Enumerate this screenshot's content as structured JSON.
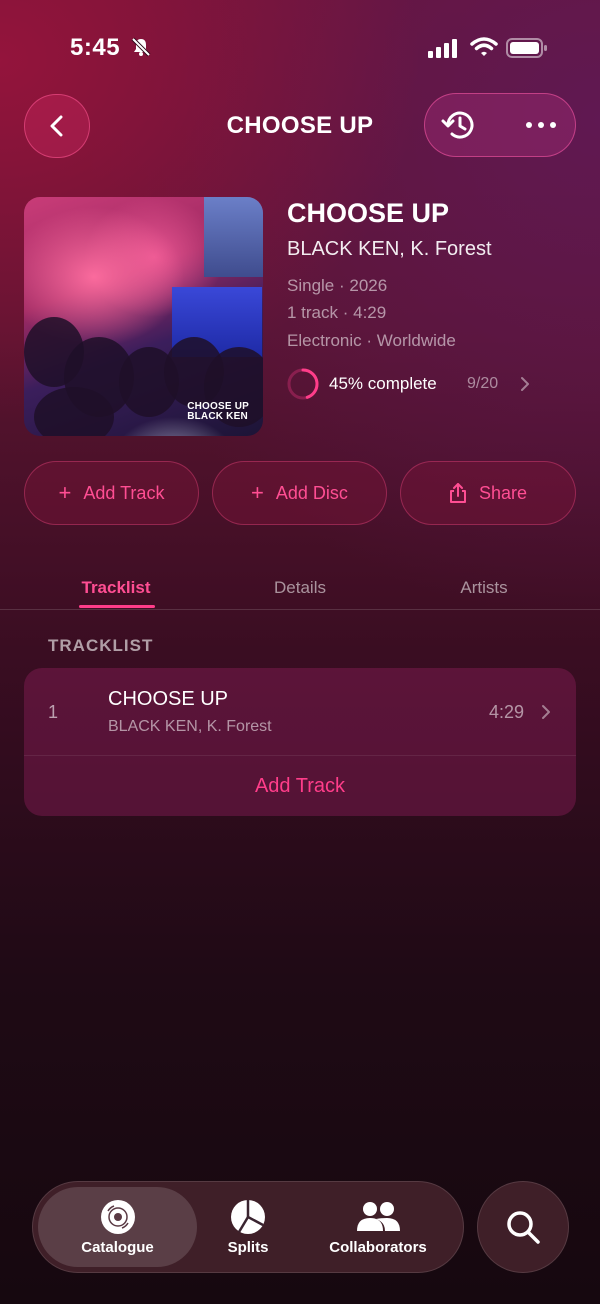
{
  "status_bar": {
    "time": "5:45"
  },
  "header": {
    "title": "CHOOSE UP"
  },
  "release": {
    "cover_text_line1": "CHOOSE UP",
    "cover_text_line2": "BLACK KEN",
    "title": "CHOOSE UP",
    "artists": "BLACK KEN, K. Forest",
    "type_year": "Single · 2026",
    "tracks_length": "1 track · 4:29",
    "genre_territory": "Electronic · Worldwide",
    "progress_percent": 45,
    "progress_label": "45% complete",
    "progress_count": "9/20"
  },
  "actions": {
    "add_track": "Add Track",
    "add_disc": "Add Disc",
    "share": "Share"
  },
  "tabs": [
    {
      "label": "Tracklist",
      "active": true
    },
    {
      "label": "Details",
      "active": false
    },
    {
      "label": "Artists",
      "active": false
    }
  ],
  "tracklist": {
    "section_label": "TRACKLIST",
    "tracks": [
      {
        "number": "1",
        "title": "CHOOSE UP",
        "artists": "BLACK KEN, K. Forest",
        "duration": "4:29"
      }
    ],
    "add_track_label": "Add Track"
  },
  "bottom_nav": {
    "items": [
      {
        "label": "Catalogue",
        "icon": "disc-icon",
        "active": true
      },
      {
        "label": "Splits",
        "icon": "pie-chart-icon",
        "active": false
      },
      {
        "label": "Collaborators",
        "icon": "people-icon",
        "active": false
      }
    ],
    "search_icon": "search-icon"
  },
  "colors": {
    "accent": "#ff3d8a",
    "background_top": "#6a1436",
    "background_bottom": "#16080f"
  }
}
